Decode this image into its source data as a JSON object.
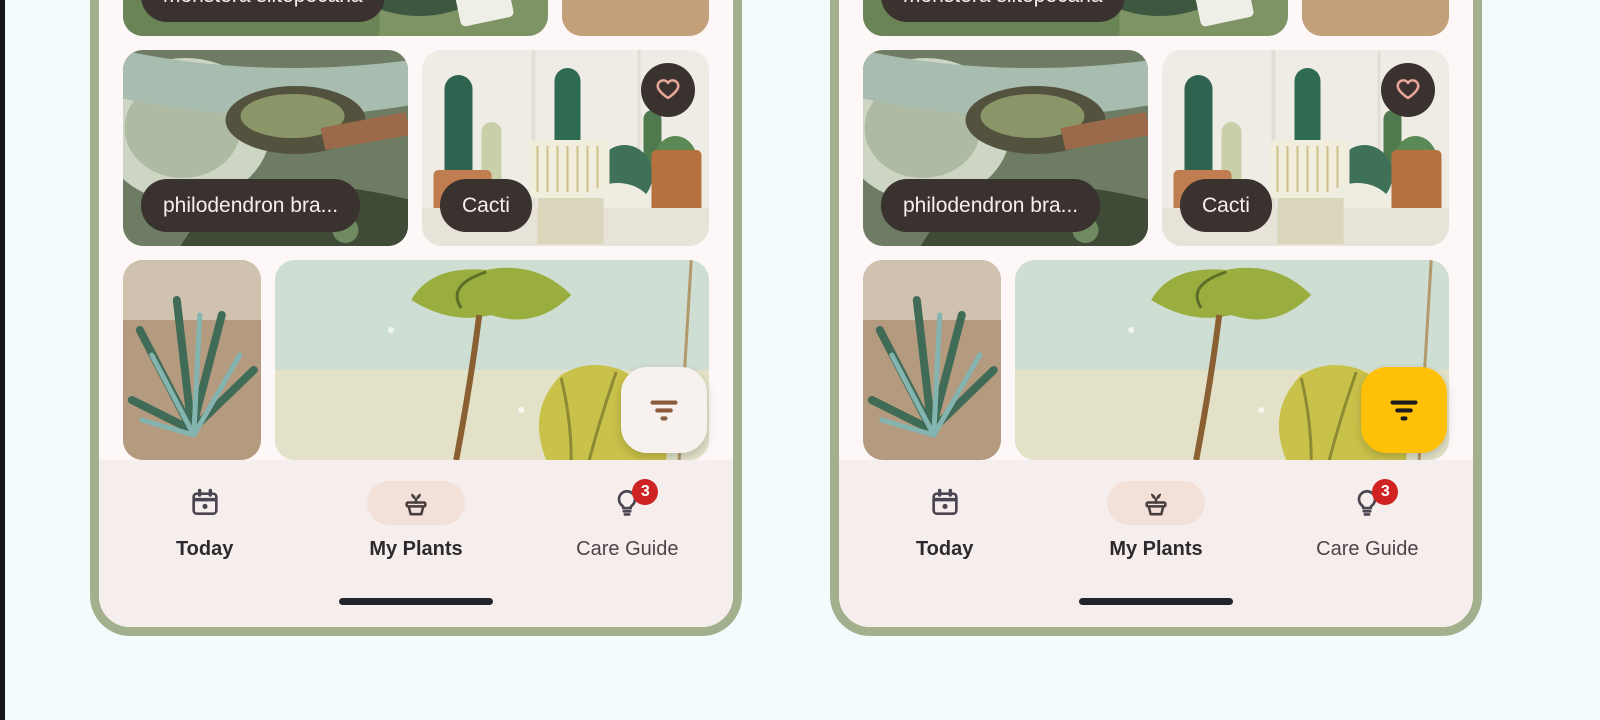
{
  "canvas": {
    "background_color": "#f2fcfd",
    "edge_strip_color": "#15171c"
  },
  "phone_frame": {
    "border_color": "#a3b08d",
    "screen_background": "#fdf7f7"
  },
  "plant_grid": {
    "rows": [
      {
        "cards": [
          {
            "name": "monstera-siltepecana",
            "label": "monstera siltepecana",
            "has_label": true,
            "favorite": false
          },
          {
            "name": "rhapis-palm",
            "label": "",
            "has_label": false,
            "favorite": false
          }
        ]
      },
      {
        "cards": [
          {
            "name": "philodendron-brandtianum",
            "label": "philodendron bra...",
            "has_label": true,
            "favorite": false
          },
          {
            "name": "cacti",
            "label": "Cacti",
            "has_label": true,
            "favorite": true
          }
        ]
      },
      {
        "cards": [
          {
            "name": "blue-palm",
            "label": "",
            "has_label": false,
            "favorite": false
          },
          {
            "name": "yellow-leaf",
            "label": "",
            "has_label": false,
            "favorite": false
          }
        ]
      }
    ],
    "pill_background": "#3a322e",
    "pill_text_color": "#f5f0ec",
    "favorite_icon": "heart-icon",
    "favorite_icon_color": "#e8a898"
  },
  "fab": {
    "icon": "filter-icon",
    "left_variant": {
      "label": "Filter",
      "background": "#f6f0ee",
      "icon_color": "#8a5c3c"
    },
    "right_variant": {
      "label": "Filter",
      "background": "#ffc107",
      "icon_color": "#1b1b1b"
    }
  },
  "bottom_nav": {
    "background": "#f6eeec",
    "active_pill_color": "#f3e0d8",
    "items": [
      {
        "label": "Today",
        "icon": "calendar-icon",
        "active": false,
        "badge": null
      },
      {
        "label": "My Plants",
        "icon": "potted-plant-icon",
        "active": true,
        "badge": null
      },
      {
        "label": "Care Guide",
        "icon": "lightbulb-icon",
        "active": false,
        "badge": "3"
      }
    ],
    "badge_color": "#cf2222",
    "home_indicator": true
  }
}
